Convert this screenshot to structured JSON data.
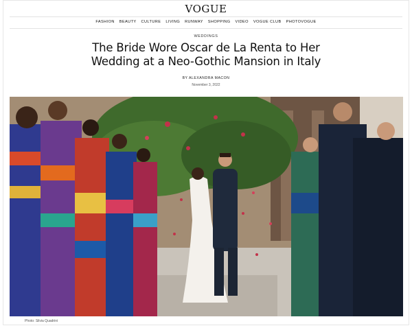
{
  "header": {
    "logo": "VOGUE",
    "nav": [
      "FASHION",
      "BEAUTY",
      "CULTURE",
      "LIVING",
      "RUNWAY",
      "SHOPPING",
      "VIDEO",
      "VOGUE CLUB",
      "PHOTOVOGUE"
    ]
  },
  "article": {
    "kicker": "WEDDINGS",
    "headline": "The Bride Wore Oscar de La Renta to Her Wedding at a Neo-Gothic Mansion in Italy",
    "byline": "BY ALEXANDRA MACON",
    "date": "November 3, 2022",
    "photo_credit": "Photo: Silvia Quadrini"
  }
}
